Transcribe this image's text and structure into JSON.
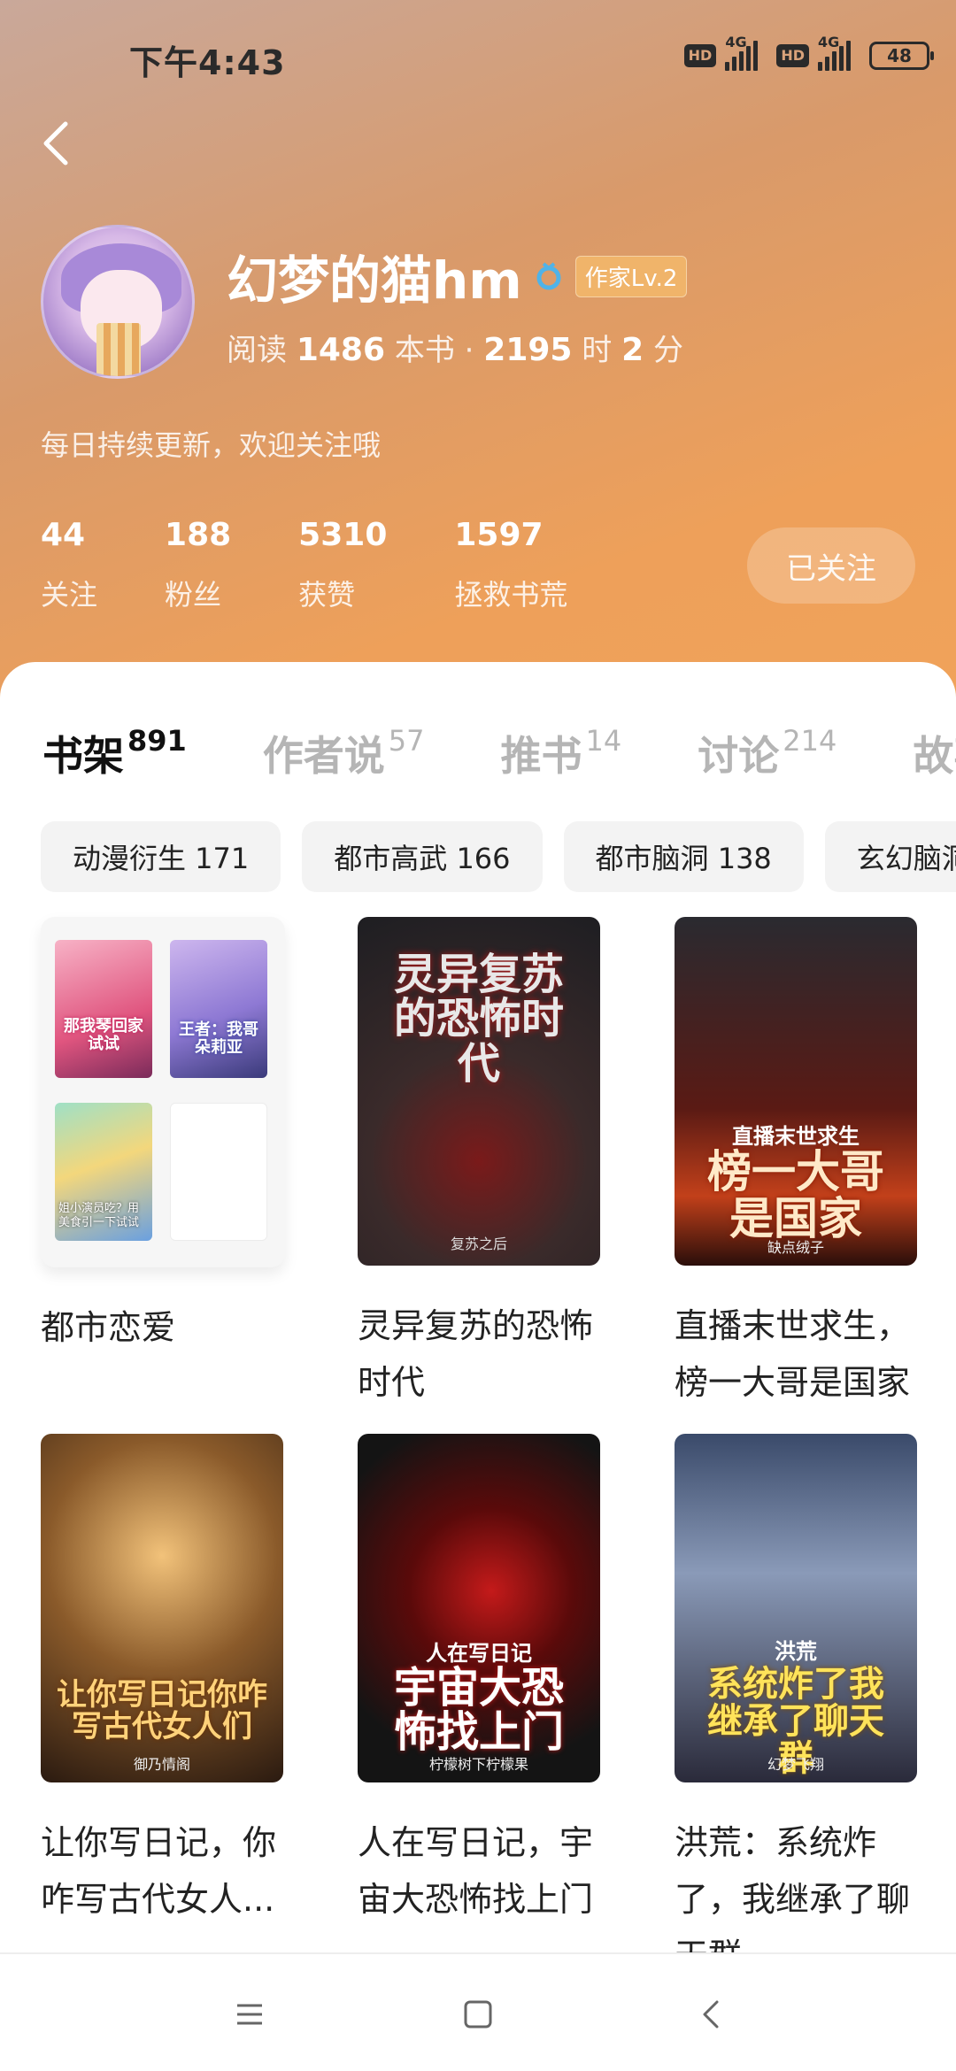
{
  "status_bar": {
    "time": "下午4:43",
    "hd1": "HD",
    "net1": "4G",
    "hd2": "HD",
    "net2": "4G",
    "battery": "48"
  },
  "profile": {
    "name": "幻梦的猫hm",
    "level": "作家Lv.2",
    "reading": {
      "prefix": "阅读",
      "books": "1486",
      "books_unit": "本书 ·",
      "hours": "2195",
      "hours_unit": "时",
      "minutes": "2",
      "minutes_unit": "分"
    },
    "bio": "每日持续更新，欢迎关注哦",
    "stats": [
      {
        "value": "44",
        "label": "关注"
      },
      {
        "value": "188",
        "label": "粉丝"
      },
      {
        "value": "5310",
        "label": "获赞"
      },
      {
        "value": "1597",
        "label": "拯救书荒"
      }
    ],
    "follow_label": "已关注"
  },
  "tabs": [
    {
      "label": "书架",
      "count": "891",
      "active": true
    },
    {
      "label": "作者说",
      "count": "57"
    },
    {
      "label": "推书",
      "count": "14"
    },
    {
      "label": "讨论",
      "count": "214"
    },
    {
      "label": "故事"
    }
  ],
  "chips": [
    "动漫衍生 171",
    "都市高武 166",
    "都市脑洞 138",
    "玄幻脑洞"
  ],
  "books": [
    {
      "title": "都市恋爱",
      "type": "folder"
    },
    {
      "title": "灵异复苏的恐怖时代",
      "cover_text": "灵异复苏的恐怖时代",
      "author": "复苏之后"
    },
    {
      "title": "直播末世求生，榜一大哥是国家",
      "cover_text_top": "直播末世求生",
      "cover_text": "榜一大哥是国家",
      "author": "缺点绒子"
    },
    {
      "title": "让你写日记，你咋写古代女人...",
      "cover_text": "让你写日记你咋写古代女人们",
      "author": "御乃情阁"
    },
    {
      "title": "人在写日记，宇宙大恐怖找上门",
      "cover_text_top": "人在写日记",
      "cover_text": "宇宙大恐怖找上门",
      "author": "柠檬树下柠檬果"
    },
    {
      "title": "洪荒：系统炸了，我继承了聊天群",
      "cover_text_top": "洪荒",
      "cover_text": "系统炸了我继承了聊天群",
      "author": "幻梦飞翔"
    }
  ],
  "folder_minis": [
    {
      "text": "那我琴回家试试"
    },
    {
      "text": "王者：我哥朵莉亚"
    },
    {
      "text": "姐小演员吃？用美食引一下试试"
    }
  ],
  "nav": {
    "menu_icon": "menu-icon",
    "home_icon": "home-icon",
    "back_icon": "back-icon"
  }
}
